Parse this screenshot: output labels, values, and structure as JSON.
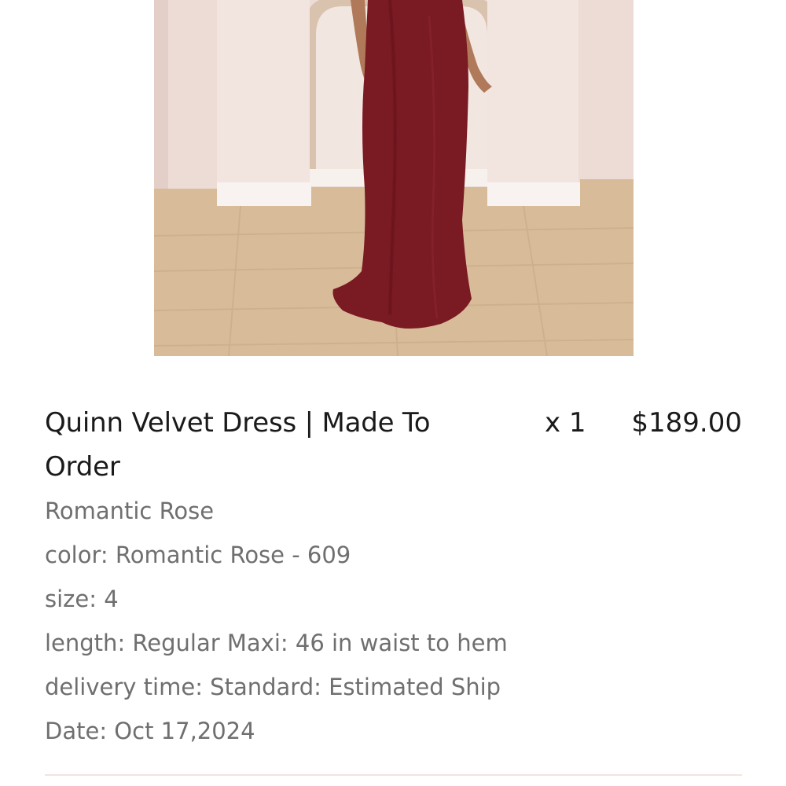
{
  "product": {
    "image_alt": "Model wearing Quinn Velvet Dress in Romantic Rose",
    "title": "Quinn Velvet Dress | Made To Order",
    "quantity": "x 1",
    "price": "$189.00",
    "variant": "Romantic Rose",
    "attributes": [
      "color: Romantic Rose - 609",
      "size: 4",
      "length: Regular Maxi: 46 in waist to hem",
      "delivery time: Standard: Estimated Ship",
      "Date: Oct 17,2024"
    ]
  },
  "colors": {
    "dress": "#7a1a22",
    "wall": "#eddcd6",
    "floor": "#d8bc9a",
    "text_primary": "#1a1a1a",
    "text_secondary": "#6f6f6f"
  }
}
